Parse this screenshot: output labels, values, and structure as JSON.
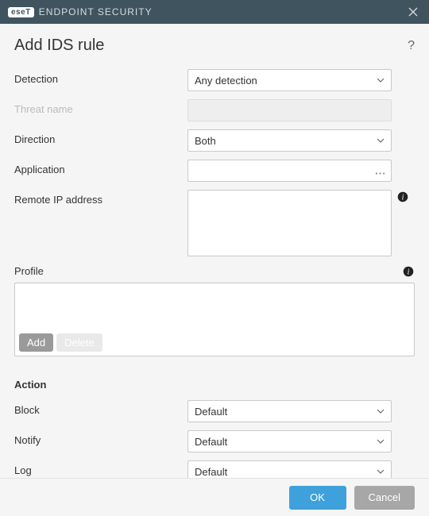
{
  "titlebar": {
    "brand_logo": "eseT",
    "brand_text": "ENDPOINT SECURITY"
  },
  "header": {
    "title": "Add IDS rule"
  },
  "form": {
    "detection": {
      "label": "Detection",
      "value": "Any detection"
    },
    "threat_name": {
      "label": "Threat name",
      "value": ""
    },
    "direction": {
      "label": "Direction",
      "value": "Both"
    },
    "application": {
      "label": "Application",
      "value": ""
    },
    "remote_ip": {
      "label": "Remote IP address",
      "value": ""
    },
    "profile": {
      "label": "Profile",
      "add": "Add",
      "delete": "Delete"
    }
  },
  "action": {
    "section_title": "Action",
    "block": {
      "label": "Block",
      "value": "Default"
    },
    "notify": {
      "label": "Notify",
      "value": "Default"
    },
    "log": {
      "label": "Log",
      "value": "Default"
    }
  },
  "footer": {
    "ok": "OK",
    "cancel": "Cancel"
  }
}
